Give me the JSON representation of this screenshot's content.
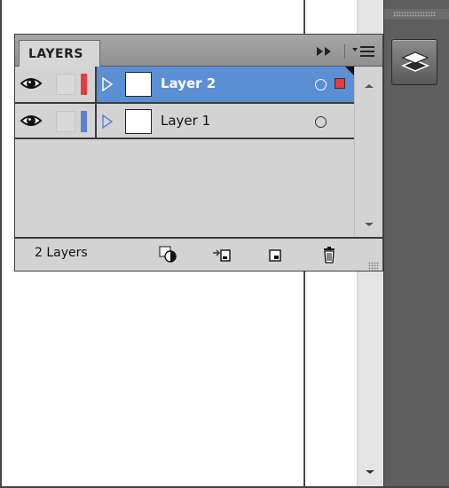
{
  "panel": {
    "tab_label": "LAYERS",
    "layer_count_text": "2 Layers"
  },
  "layers": [
    {
      "name": "Layer 2",
      "selected": true,
      "color": "#e8393c"
    },
    {
      "name": "Layer 1",
      "selected": false,
      "color": "#5b7fd3"
    }
  ],
  "colors": {
    "selection": "#5b8fd3",
    "panel_bg": "#d3d3d3",
    "dock_bg": "#5e5e5e"
  },
  "icons": {
    "title_bar": [
      "collapse-icon",
      "panel-menu-icon"
    ],
    "row": [
      "eye-icon",
      "lock-toggle",
      "expand-arrow-icon",
      "target-circle-icon"
    ],
    "footer": [
      "make-clipping-mask-icon",
      "create-sublayer-icon",
      "create-new-layer-icon",
      "delete-layer-icon"
    ],
    "dock": [
      "layers-icon"
    ]
  }
}
